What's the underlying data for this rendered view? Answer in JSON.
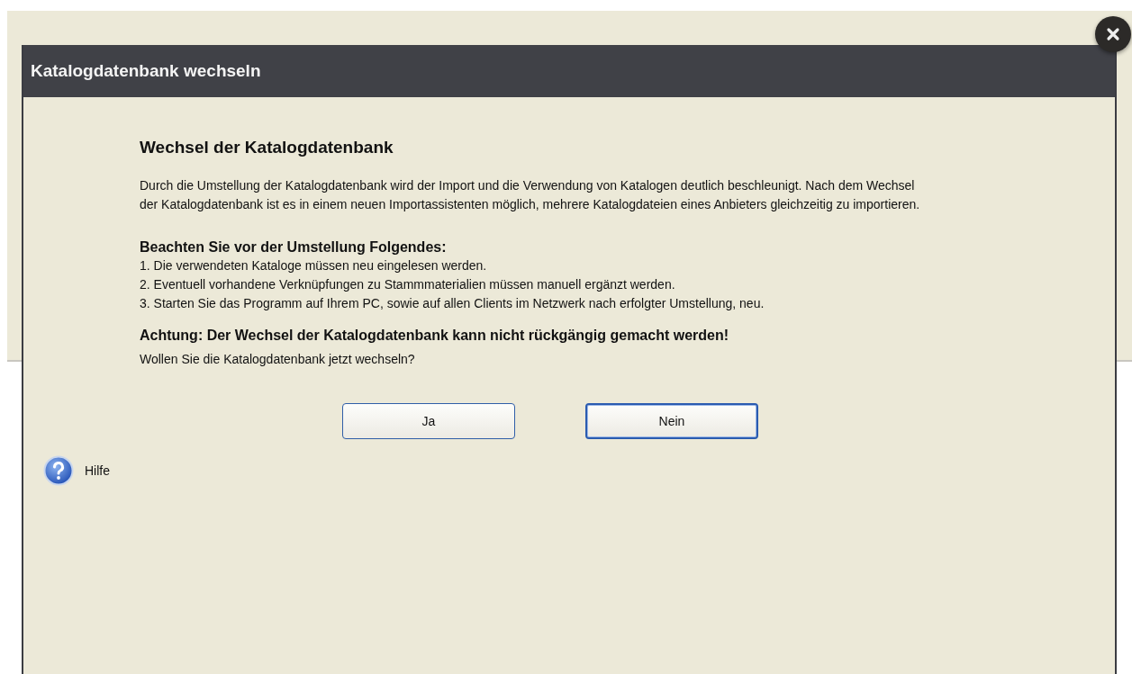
{
  "window": {
    "title": "Katalogdatenbank wechseln"
  },
  "heading": "Wechsel der Katalogdatenbank",
  "intro": "Durch die Umstellung der Katalogdatenbank wird der Import und die Verwendung von Katalogen deutlich beschleunigt. Nach dem Wechsel der Katalogdatenbank ist es in einem neuen Importassistenten möglich, mehrere Katalogdateien eines Anbieters gleichzeitig zu importieren.",
  "notice_heading": "Beachten Sie vor der Umstellung Folgendes:",
  "notes": [
    "1. Die verwendeten Kataloge müssen neu eingelesen werden.",
    "2. Eventuell vorhandene Verknüpfungen zu Stammmaterialien müssen manuell ergänzt werden.",
    "3. Starten Sie das Programm auf Ihrem PC, sowie auf allen Clients im Netzwerk nach erfolgter Umstellung, neu."
  ],
  "warning": "Achtung: Der Wechsel der Katalogdatenbank kann nicht rückgängig gemacht werden!",
  "question": "Wollen Sie die Katalogdatenbank jetzt wechseln?",
  "buttons": [
    {
      "label": "Ja",
      "default": false
    },
    {
      "label": "Nein",
      "default": true
    }
  ],
  "help": {
    "label": "Hilfe"
  }
}
